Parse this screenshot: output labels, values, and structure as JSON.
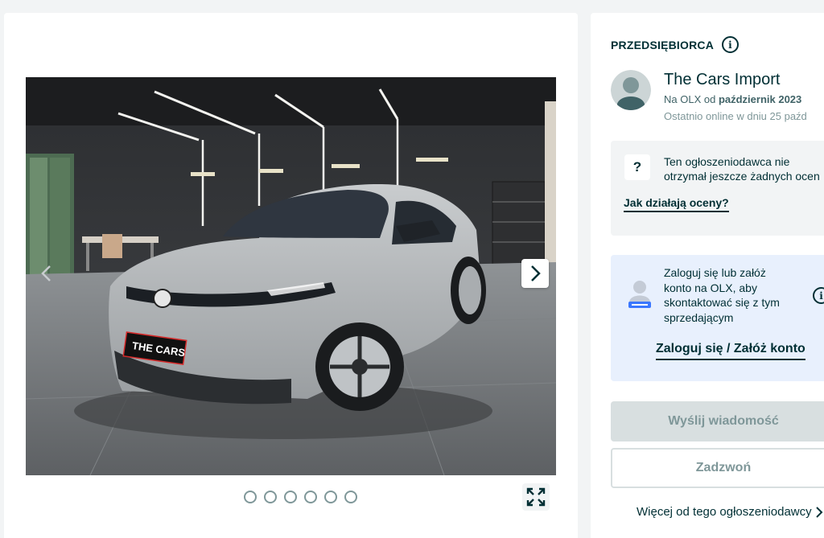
{
  "gallery": {
    "photo_alt": "",
    "brand_plate": "THE CARS",
    "dots_count": 6,
    "icons": {
      "next": "chevron-right-icon",
      "prev": "chevron-left-icon",
      "fullscreen": "expand-icon"
    }
  },
  "seller": {
    "type_label": "PRZEDSIĘBIORCA",
    "name": "The Cars Import",
    "since_prefix": "Na OLX od ",
    "since_value": "październik 2023",
    "last_online": "Ostatnio online w dniu 25 paźd"
  },
  "ratings": {
    "badge": "?",
    "text_line1": "Ten ogłoszeniodawca nie",
    "text_line2": "otrzymał jeszcze żadnych ocen",
    "link": "Jak działają oceny?"
  },
  "login": {
    "text": "Zaloguj się lub załóż konto na OLX, aby skontaktować się z tym sprzedającym",
    "link": "Zaloguj się / Załóż konto"
  },
  "actions": {
    "message": "Wyślij wiadomość",
    "call": "Zadzwoń",
    "more": "Więcej od tego ogłoszeniodawcy"
  },
  "colors": {
    "primary_text": "#002f34",
    "muted_text": "#7f9799",
    "login_bg": "#e8f0fd",
    "disabled_btn": "#d8dfe0"
  }
}
